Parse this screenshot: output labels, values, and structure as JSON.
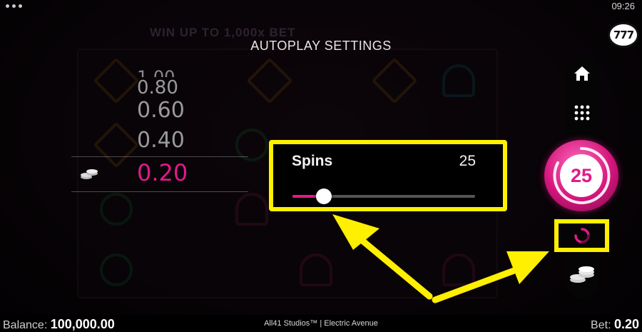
{
  "status_bar": {
    "time": "09:26"
  },
  "banner": {
    "text": "WIN UP TO 1,000x BET"
  },
  "panel": {
    "title": "AUTOPLAY SETTINGS"
  },
  "bet_selector": {
    "values": [
      "1.00",
      "0.80",
      "0.60",
      "0.40"
    ],
    "selected": "0.20",
    "selected_color": "#e2198b"
  },
  "spins": {
    "label": "Spins",
    "value": "25",
    "slider_fraction": 0.17
  },
  "side_menu": {
    "logo": "777",
    "icons": [
      "home-icon",
      "grid-menu-icon",
      "autoplay-icon",
      "coins-icon"
    ]
  },
  "spin_button": {
    "label": "25",
    "color": "#e2198b"
  },
  "footer": {
    "balance_label": "Balance:",
    "balance_value": "100,000.00",
    "studio": "All41 Studios™ | Electric Avenue",
    "bet_label": "Bet:",
    "bet_value": "0.20"
  },
  "colors": {
    "accent": "#e2198b",
    "highlight": "#ffef00"
  }
}
